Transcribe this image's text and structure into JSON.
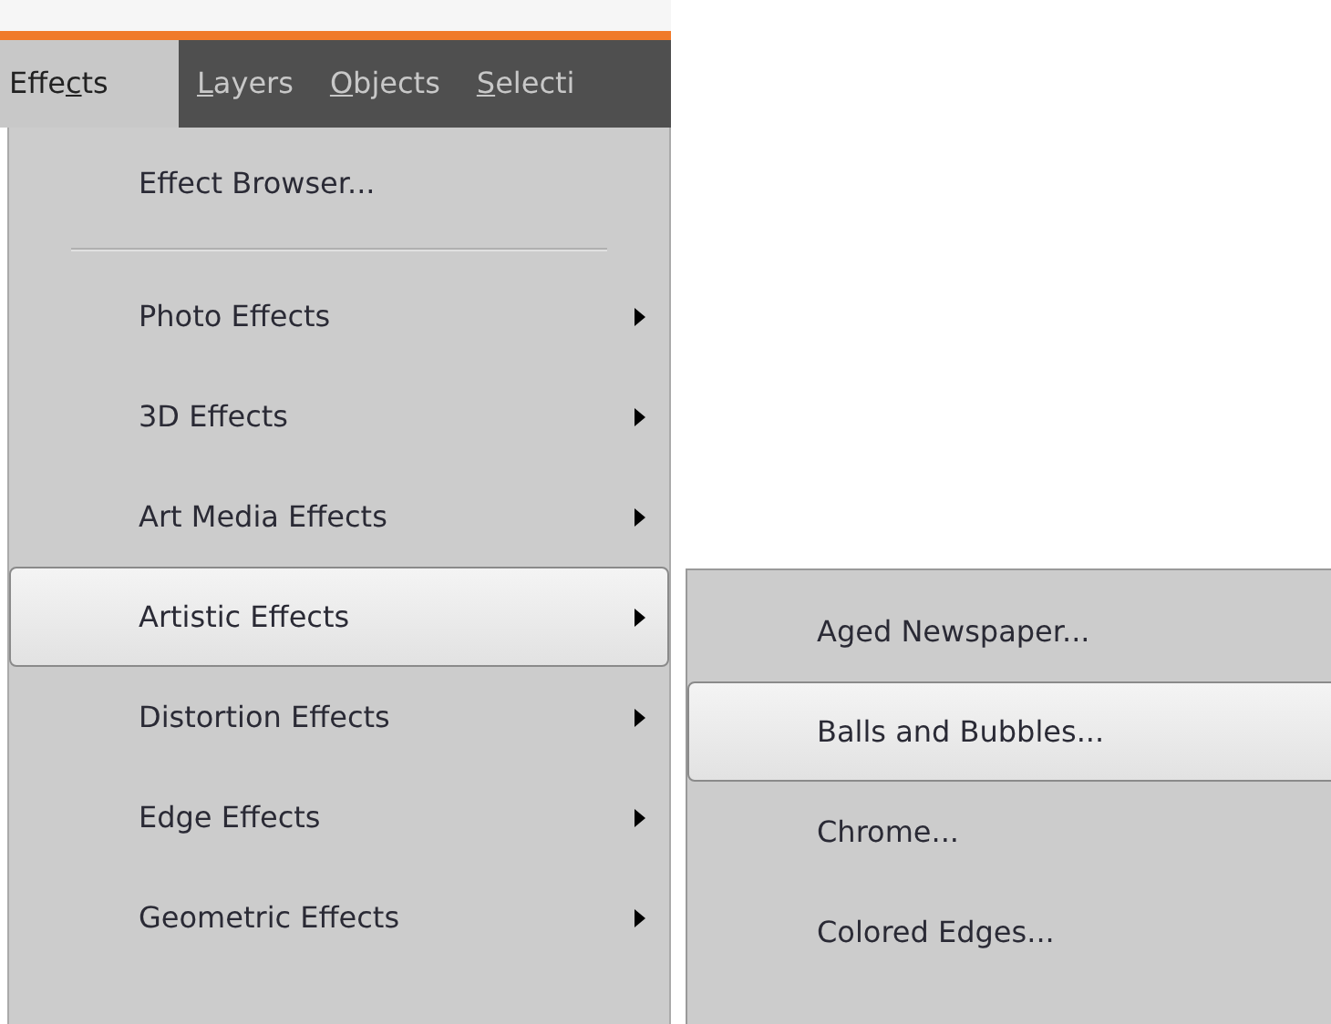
{
  "menu_bar": [
    {
      "before": "Effe",
      "key": "c",
      "after": "ts",
      "selected": true
    },
    {
      "key": "L",
      "after": "ayers",
      "selected": false
    },
    {
      "key": "O",
      "after": "bjects",
      "selected": false
    },
    {
      "key": "S",
      "after": "electi",
      "selected": false
    }
  ],
  "menu": [
    {
      "kind": "item",
      "label": "Effect Browser...",
      "submenu": false,
      "selected": false
    },
    {
      "kind": "separator"
    },
    {
      "kind": "item",
      "label": "Photo Effects",
      "submenu": true,
      "selected": false
    },
    {
      "kind": "item",
      "label": "3D Effects",
      "submenu": true,
      "selected": false
    },
    {
      "kind": "item",
      "label": "Art Media Effects",
      "submenu": true,
      "selected": false
    },
    {
      "kind": "item",
      "label": "Artistic Effects",
      "submenu": true,
      "selected": true
    },
    {
      "kind": "item",
      "label": "Distortion Effects",
      "submenu": true,
      "selected": false
    },
    {
      "kind": "item",
      "label": "Edge Effects",
      "submenu": true,
      "selected": false
    },
    {
      "kind": "item",
      "label": "Geometric Effects",
      "submenu": true,
      "selected": false
    }
  ],
  "submenu": [
    {
      "label": "Aged Newspaper...",
      "selected": false
    },
    {
      "label": "Balls and Bubbles...",
      "selected": true
    },
    {
      "label": "Chrome...",
      "selected": false
    },
    {
      "label": "Colored Edges...",
      "selected": false
    }
  ]
}
